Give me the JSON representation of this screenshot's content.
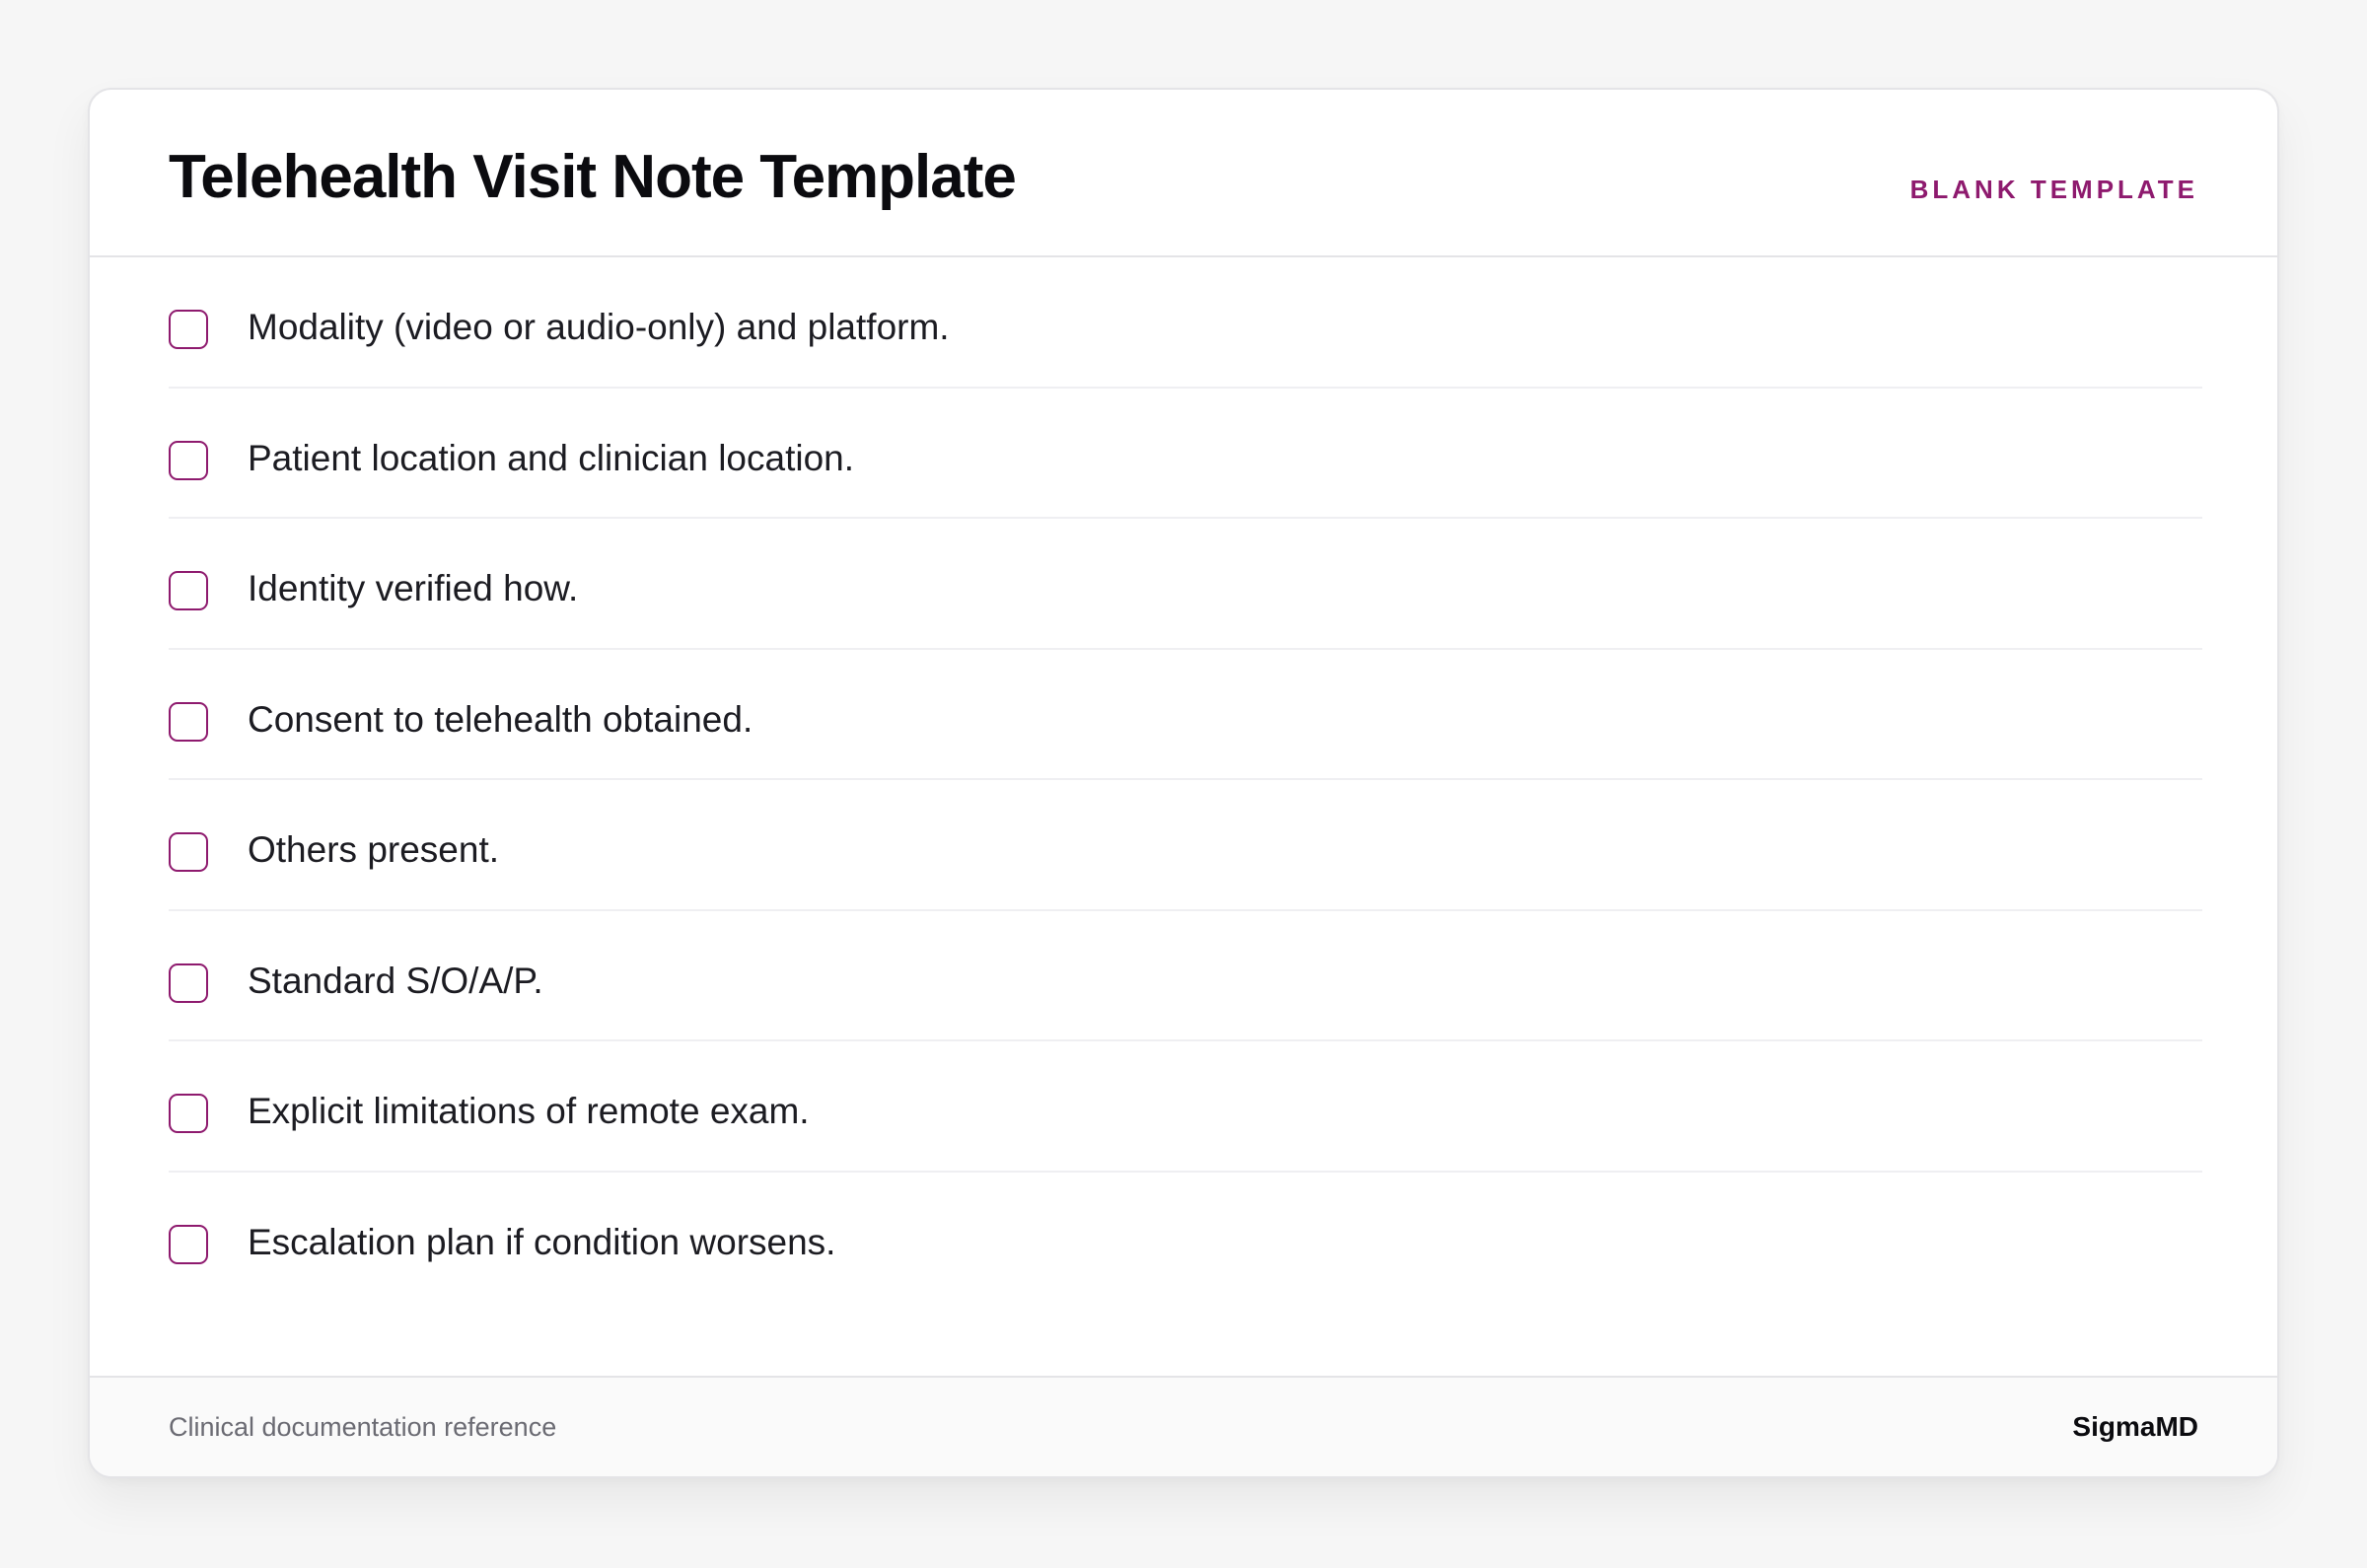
{
  "header": {
    "title": "Telehealth Visit Note Template",
    "badge": "BLANK TEMPLATE"
  },
  "checklist": {
    "items": [
      {
        "label": "Modality (video or audio-only) and platform.",
        "checked": false
      },
      {
        "label": "Patient location and clinician location.",
        "checked": false
      },
      {
        "label": "Identity verified how.",
        "checked": false
      },
      {
        "label": "Consent to telehealth obtained.",
        "checked": false
      },
      {
        "label": "Others present.",
        "checked": false
      },
      {
        "label": "Standard S/O/A/P.",
        "checked": false
      },
      {
        "label": "Explicit limitations of remote exam.",
        "checked": false
      },
      {
        "label": "Escalation plan if condition worsens.",
        "checked": false
      }
    ]
  },
  "footer": {
    "note": "Clinical documentation reference",
    "brand": "SigmaMD"
  },
  "colors": {
    "accent": "#8e1a6e",
    "text": "#1c1c22",
    "background": "#f6f6f6",
    "card": "#ffffff"
  }
}
